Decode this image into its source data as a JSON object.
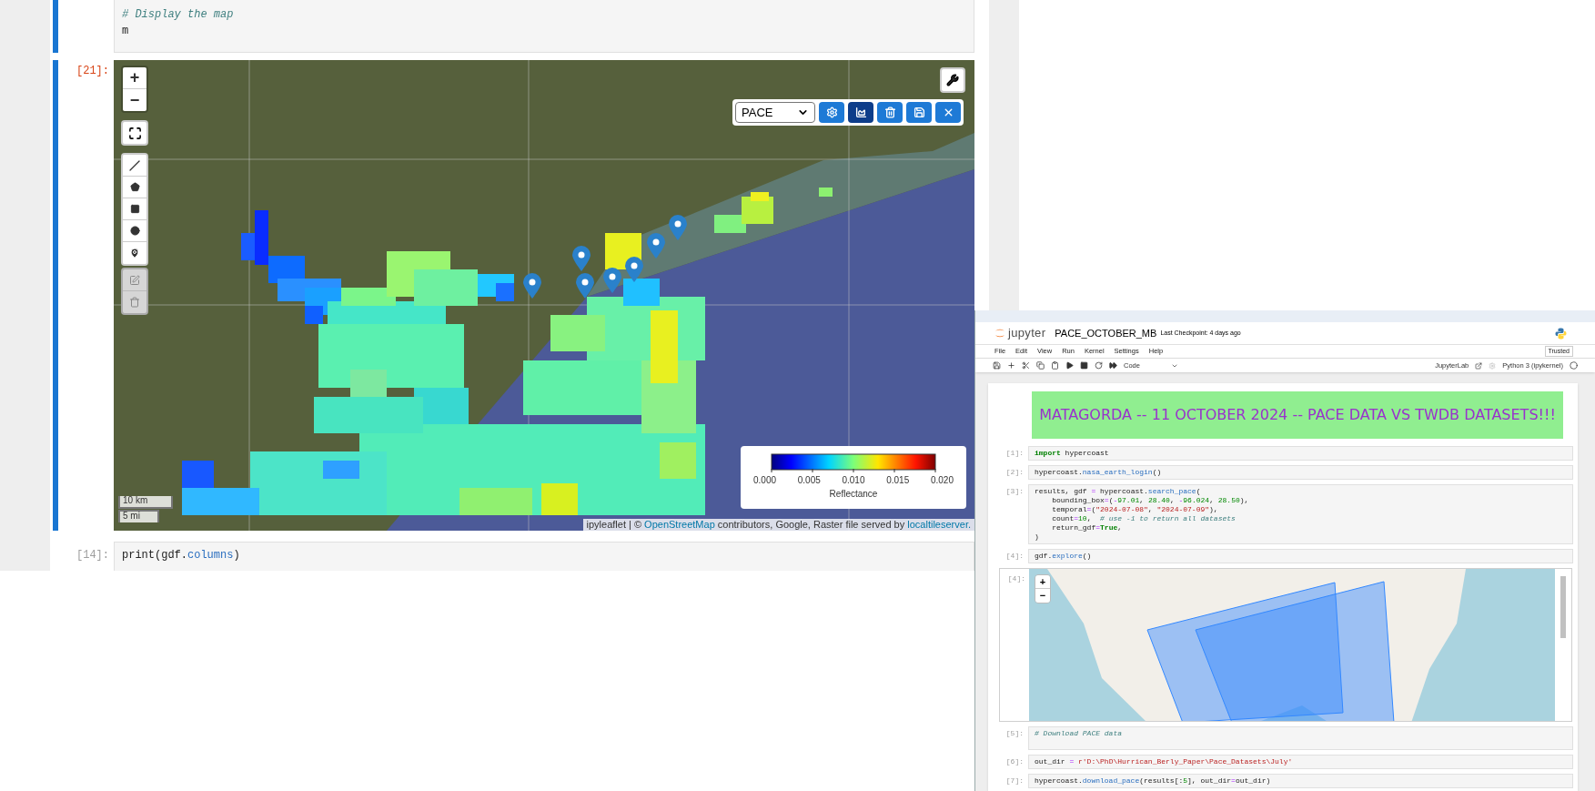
{
  "left_notebook": {
    "top_cell": {
      "lines": [
        [
          {
            "text": "# Display the map",
            "kind": "comment"
          }
        ],
        [
          {
            "text": "m",
            "kind": "plain"
          }
        ]
      ]
    },
    "map_cell": {
      "prompt": "[21]:",
      "zoom_in": "+",
      "zoom_out": "−",
      "layer": "PACE",
      "toolbar_buttons": [
        {
          "kind": "settings",
          "selected": false
        },
        {
          "kind": "chart",
          "selected": true
        },
        {
          "kind": "delete",
          "selected": false
        },
        {
          "kind": "save",
          "selected": false
        },
        {
          "kind": "close",
          "selected": false
        }
      ],
      "legend": {
        "ticks": [
          "0.000",
          "0.005",
          "0.010",
          "0.015",
          "0.020"
        ],
        "label": "Reflectance"
      },
      "scale": [
        "10 km",
        "5 mi"
      ],
      "attribution": {
        "prefix": "ipyleaflet | © ",
        "osm_link": "OpenStreetMap",
        "middle": " contributors, Google, Raster file served by ",
        "server_link": "localtileserver."
      }
    },
    "next_cell": {
      "prompt": "[14]:",
      "lines": [
        [
          {
            "text": "print(gdf.",
            "kind": "plain"
          },
          {
            "text": "columns",
            "kind": "attr"
          },
          {
            "text": ")",
            "kind": "plain"
          }
        ]
      ]
    }
  },
  "jupyter_window": {
    "logo_text": "jupyter",
    "notebook_name": "PACE_OCTOBER_MB",
    "checkpoint": "Last Checkpoint: 4 days ago",
    "menu": [
      "File",
      "Edit",
      "View",
      "Run",
      "Kernel",
      "Settings",
      "Help"
    ],
    "trusted": "Trusted",
    "cell_type": "Code",
    "launcher": "JupyterLab",
    "kernel": "Python 3 (ipykernel)",
    "banner": "MATAGORDA -- 11 OCTOBER 2024 -- PACE DATA VS TWDB DATASETS!!!",
    "cells": [
      {
        "kind": "code",
        "prompt": "[1]:",
        "lines": [
          [
            {
              "text": "import",
              "kind": "kw"
            },
            {
              "text": " hypercoast",
              "kind": "plain"
            }
          ]
        ]
      },
      {
        "kind": "code",
        "prompt": "[2]:",
        "lines": [
          [
            {
              "text": "hypercoast.",
              "kind": "plain"
            },
            {
              "text": "nasa_earth_login",
              "kind": "attr"
            },
            {
              "text": "()",
              "kind": "plain"
            }
          ]
        ]
      },
      {
        "kind": "code",
        "prompt": "[3]:",
        "lines": [
          [
            {
              "text": "results, gdf ",
              "kind": "plain"
            },
            {
              "text": "=",
              "kind": "op"
            },
            {
              "text": " hypercoast.",
              "kind": "plain"
            },
            {
              "text": "search_pace",
              "kind": "attr"
            },
            {
              "text": "(",
              "kind": "plain"
            }
          ],
          [
            {
              "text": "    bounding_box",
              "kind": "plain"
            },
            {
              "text": "=",
              "kind": "op"
            },
            {
              "text": "(",
              "kind": "plain"
            },
            {
              "text": "-",
              "kind": "op"
            },
            {
              "text": "97.01",
              "kind": "num"
            },
            {
              "text": ", ",
              "kind": "plain"
            },
            {
              "text": "28.40",
              "kind": "num"
            },
            {
              "text": ", ",
              "kind": "plain"
            },
            {
              "text": "-",
              "kind": "op"
            },
            {
              "text": "96.024",
              "kind": "num"
            },
            {
              "text": ", ",
              "kind": "plain"
            },
            {
              "text": "28.50",
              "kind": "num"
            },
            {
              "text": "),",
              "kind": "plain"
            }
          ],
          [
            {
              "text": "    temporal",
              "kind": "plain"
            },
            {
              "text": "=",
              "kind": "op"
            },
            {
              "text": "(",
              "kind": "plain"
            },
            {
              "text": "\"2024-07-08\"",
              "kind": "str"
            },
            {
              "text": ", ",
              "kind": "plain"
            },
            {
              "text": "\"2024-07-09\"",
              "kind": "str"
            },
            {
              "text": "),",
              "kind": "plain"
            }
          ],
          [
            {
              "text": "    count",
              "kind": "plain"
            },
            {
              "text": "=",
              "kind": "op"
            },
            {
              "text": "10",
              "kind": "num"
            },
            {
              "text": ",  ",
              "kind": "plain"
            },
            {
              "text": "# use -1 to return all datasets",
              "kind": "comment"
            }
          ],
          [
            {
              "text": "    return_gdf",
              "kind": "plain"
            },
            {
              "text": "=",
              "kind": "op"
            },
            {
              "text": "True",
              "kind": "kw"
            },
            {
              "text": ",",
              "kind": "plain"
            }
          ],
          [
            {
              "text": ")",
              "kind": "plain"
            }
          ]
        ]
      },
      {
        "kind": "code",
        "prompt": "[4]:",
        "lines": [
          [
            {
              "text": "gdf.",
              "kind": "plain"
            },
            {
              "text": "explore",
              "kind": "attr"
            },
            {
              "text": "()",
              "kind": "plain"
            }
          ]
        ]
      },
      {
        "kind": "map",
        "prompt": "[4]:",
        "zoom_in": "+",
        "zoom_out": "−"
      },
      {
        "kind": "code",
        "prompt": "[5]:",
        "lines": [
          [
            {
              "text": "# Download PACE data",
              "kind": "comment"
            }
          ]
        ]
      },
      {
        "kind": "code",
        "prompt": "[6]:",
        "lines": [
          [
            {
              "text": "out_dir ",
              "kind": "plain"
            },
            {
              "text": "=",
              "kind": "op"
            },
            {
              "text": " r'D:\\PhD\\Hurrican_Berly_Paper\\Pace_Datasets\\July'",
              "kind": "str"
            }
          ]
        ]
      },
      {
        "kind": "code",
        "prompt": "[7]:",
        "lines": [
          [
            {
              "text": "hypercoast.",
              "kind": "plain"
            },
            {
              "text": "download_pace",
              "kind": "attr"
            },
            {
              "text": "(results[:",
              "kind": "plain"
            },
            {
              "text": "5",
              "kind": "num"
            },
            {
              "text": "], out_dir",
              "kind": "plain"
            },
            {
              "text": "=",
              "kind": "op"
            },
            {
              "text": "out_dir)",
              "kind": "plain"
            }
          ]
        ]
      }
    ]
  }
}
